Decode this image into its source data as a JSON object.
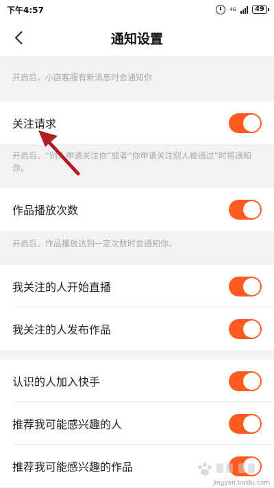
{
  "status_bar": {
    "time": "下午4:57",
    "network": "4G",
    "battery": "49"
  },
  "header": {
    "title": "通知设置"
  },
  "hints": [
    "开启后，小店客服有新消息时会通知你",
    "开启后，“别人申请关注你”或者“你申请关注别人被通过”时将通知你。",
    "开启后，作品播放达到一定次数时会通知你。"
  ],
  "settings": [
    {
      "label": "关注请求",
      "on": true
    },
    {
      "label": "作品播放次数",
      "on": true
    },
    {
      "label": "我关注的人开始直播",
      "on": true
    },
    {
      "label": "我关注的人发布作品",
      "on": true
    },
    {
      "label": "认识的人加入快手",
      "on": true
    },
    {
      "label": "推荐我可能感兴趣的人",
      "on": true
    },
    {
      "label": "推荐我可能感兴趣的作品",
      "on": true
    }
  ],
  "colors": {
    "accent": "#ff5b1f",
    "annotation_arrow": "#b01e24",
    "background": "#f2f2f2"
  },
  "watermark": {
    "text": "jingyan.baidu.com"
  }
}
